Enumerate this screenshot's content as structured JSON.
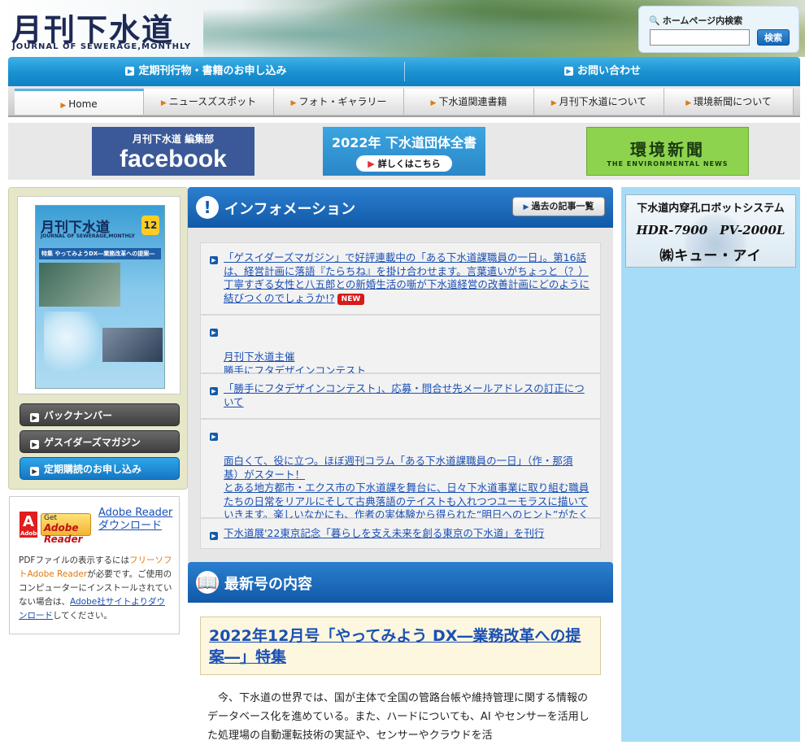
{
  "header": {
    "logo_title": "月刊下水道",
    "logo_subtitle": "JOURNAL OF SEWERAGE,MONTHLY",
    "search_label": "ホームページ内検索",
    "search_value": "",
    "search_button": "検索"
  },
  "topbar": {
    "items": [
      "定期刊行物・書籍のお申し込み",
      "お問い合わせ"
    ]
  },
  "nav": {
    "tabs": [
      "Home",
      "ニュースズスポット",
      "フォト・ギャラリー",
      "下水道関連書籍",
      "月刊下水道について",
      "環境新聞について"
    ],
    "active": "Home"
  },
  "banners": {
    "facebook_small": "月刊下水道 編集部",
    "facebook_big": "facebook",
    "dantai_title": "2022年 下水道団体全書",
    "dantai_pill": "詳しくはこちら",
    "kankyo_jp": "環境新聞",
    "kankyo_en": "THE ENVIRONMENTAL NEWS"
  },
  "sidebar": {
    "cover": {
      "title": "月刊下水道",
      "subtitle": "JOURNAL OF SEWERAGE,MONTHLY",
      "issue": "12",
      "feature": "特集 やってみようDX―業務改革への提案―"
    },
    "buttons": [
      "バックナンバー",
      "ゲスイダーズマガジン",
      "定期購読のお申し込み"
    ],
    "adobe": {
      "logo_get": "Get",
      "logo_name": "Adobe Reader",
      "link": "Adobe Reader ダウンロード",
      "note_pre": "PDFファイルの表示するには",
      "note_orange": "フリーソフトAdobe Reader",
      "note_mid": "が必要です。ご使用のコンピューターにインストールされていない場合は、",
      "note_link": "Adobe社サイトよりダウンロード",
      "note_post": "してください。"
    }
  },
  "info": {
    "title": "インフォメーション",
    "archive_button": "過去の記事一覧",
    "items": [
      {
        "text": "「ゲスイダーズマガジン」で好評連載中の「ある下水道課職員の一日」。第16話は、経営計画に落語『たらちね』を掛け合わせます。言葉遣いがちょっと（？）丁寧すぎる女性と八五郎との新婚生活の噺が下水道経営の改善計画にどのように結びつくのでしょうか!?",
        "badge": "NEW"
      },
      {
        "text": "月刊下水道主催\n勝手にフタデザインコンテスト\n募集要項と応募用紙をアップいたしました。"
      },
      {
        "text": "「勝手にフタデザインコンテスト」、応募・問合せ先メールアドレスの訂正について"
      },
      {
        "text": "面白くて、役に立つ。ほぼ週刊コラム「ある下水道課職員の一日」（作・那須 基）がスタート！\nとある地方都市・エクス市の下水道課を舞台に、日々下水道事業に取り組む職員たちの日常をリアルにそして古典落語のテイストも入れつつユーモラスに描いていきます。楽しいなかにも、作者の実体験から得られた“明日へのヒント”がたくさん散りばめられています！"
      },
      {
        "text": "下水道展'22東京記念「暮らしを支え未来を創る東京の下水道」を刊行"
      }
    ]
  },
  "latest": {
    "title": "最新号の内容",
    "feature_title": "2022年12月号「やってみよう DX―業務改革への提案―」特集",
    "body": "今、下水道の世界では、国が主体で全国の管路台帳や維持管理に関する情報のデータベース化を進めている。また、ハードについても、AI やセンサーを活用した処理場の自動運転技術の実証や、センサーやクラウドを活"
  },
  "right": {
    "robot_line1": "下水道内穿孔ロボットシステム",
    "robot_line2": "HDR-7900　PV-2000L",
    "robot_line3": "㈱キュー・アイ"
  },
  "colors": {
    "topbar_blue": "#1b93d3",
    "section_blue": "#1459a8",
    "link_blue": "#1a4fb4",
    "new_red": "#d81a1a",
    "right_bg": "#a6dcf7"
  }
}
